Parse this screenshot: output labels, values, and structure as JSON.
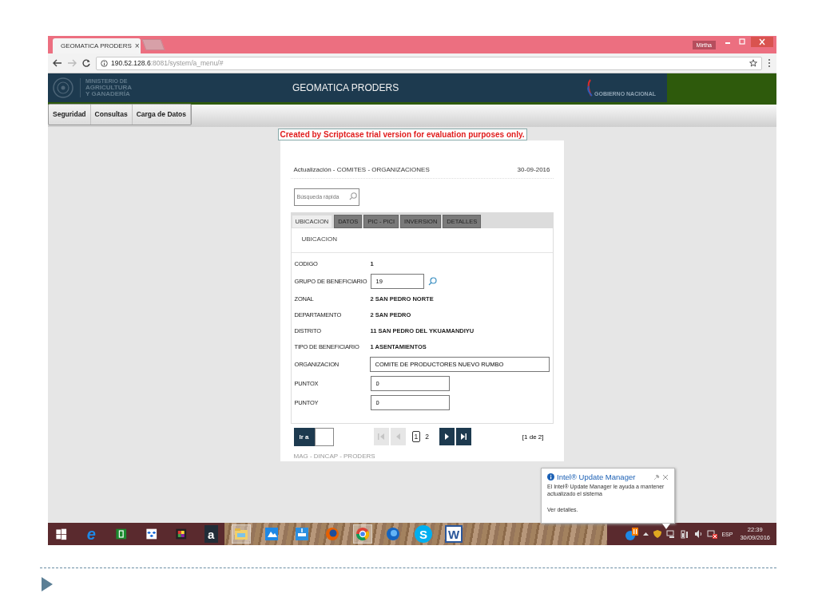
{
  "browser": {
    "tab_title": "GEOMATICA PRODERS",
    "tab_close": "×",
    "url_host": "190.52.128.6",
    "url_path": ":8081/system/a_menu/#",
    "user": "Mirtha"
  },
  "header": {
    "ministry_lines": [
      "MINISTERIO DE",
      "AGRICULTURA",
      "Y GANADERÍA"
    ],
    "title": "GEOMATICA PRODERS",
    "government": "GOBIERNO NACIONAL"
  },
  "menu": [
    {
      "label": "Seguridad"
    },
    {
      "label": "Consultas"
    },
    {
      "label": "Carga de Datos"
    }
  ],
  "trial_notice": "Created by Scriptcase trial version for evaluation purposes only.",
  "form": {
    "title": "Actualización - COMITES - ORGANIZACIONES",
    "date": "30-09-2016",
    "search": {
      "placeholder": "Búsqueda rápida"
    },
    "tabs": [
      {
        "label": "UBICACION",
        "selected": true
      },
      {
        "label": "DATOS",
        "selected": false
      },
      {
        "label": "PIC - PICI",
        "selected": false
      },
      {
        "label": "INVERSION",
        "selected": false
      },
      {
        "label": "DETALLES",
        "selected": false
      }
    ],
    "section": "UBICACION",
    "fields": [
      {
        "label": "CODIGO",
        "value": "1",
        "kind": "text"
      },
      {
        "label": "GRUPO DE BENEFICIARIO",
        "value": "19",
        "kind": "lookup"
      },
      {
        "label": "ZONAL",
        "value": "2 SAN PEDRO NORTE",
        "kind": "text"
      },
      {
        "label": "DEPARTAMENTO",
        "value": "2 SAN PEDRO",
        "kind": "text"
      },
      {
        "label": "DISTRITO",
        "value": "11 SAN PEDRO DEL YKUAMANDIYU",
        "kind": "text"
      },
      {
        "label": "TIPO DE BENEFICIARIO",
        "value": "1 ASENTAMIENTOS",
        "kind": "text"
      },
      {
        "label": "ORGANIZACION",
        "value": "COMITE DE PRODUCTORES NUEVO RUMBO",
        "kind": "wide"
      },
      {
        "label": "PUNTOX",
        "value": "0",
        "kind": "input"
      },
      {
        "label": "PUNTOY",
        "value": "0",
        "kind": "input"
      }
    ],
    "pager": {
      "goto_label": "Ir a",
      "buttons": [
        {
          "kind": "first",
          "disabled": true
        },
        {
          "kind": "prev",
          "disabled": true
        },
        {
          "kind": "next",
          "disabled": false
        },
        {
          "kind": "last",
          "disabled": false
        }
      ],
      "pages": [
        {
          "label": "1",
          "selected": true
        },
        {
          "label": "2",
          "selected": false
        }
      ],
      "summary": "[1 de 2]"
    },
    "footer": "MAG - DINCAP - PRODERS"
  },
  "notification": {
    "title": "Intel® Update Manager",
    "body": "El Intel® Update Manager le ayuda a mantener actualizado el sistema",
    "link": "Ver detalles."
  },
  "taskbar": {
    "apps": [
      {
        "kind": "start",
        "open": false
      },
      {
        "kind": "ie",
        "glyph": "e",
        "open": false
      },
      {
        "kind": "store",
        "open": false
      },
      {
        "kind": "dropbox",
        "open": false
      },
      {
        "kind": "photos",
        "open": false
      },
      {
        "kind": "amazon",
        "glyph": "a",
        "open": false
      },
      {
        "kind": "explorer",
        "open": true
      },
      {
        "kind": "onedrive",
        "open": false
      },
      {
        "kind": "network",
        "open": false
      },
      {
        "kind": "firefox",
        "open": false
      },
      {
        "kind": "chrome",
        "open": true
      },
      {
        "kind": "firefoxdev",
        "open": false
      },
      {
        "kind": "skype",
        "glyph": "S",
        "open": false
      },
      {
        "kind": "word",
        "glyph": "W",
        "open": false
      }
    ],
    "language": "ESP",
    "time": "22:39",
    "date": "30/09/2016"
  }
}
